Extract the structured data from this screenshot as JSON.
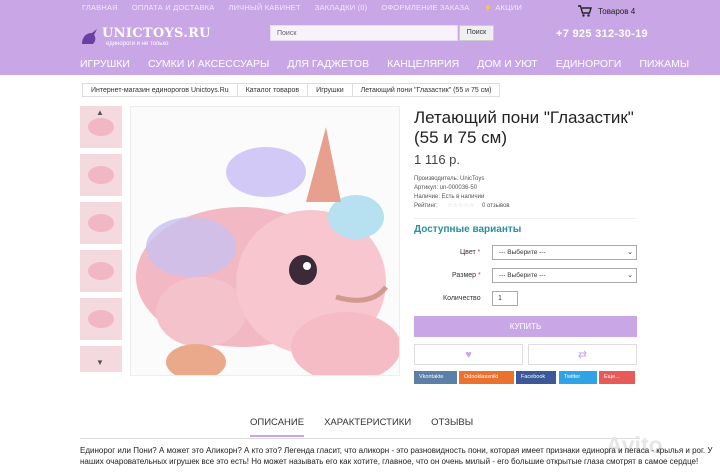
{
  "toplinks": [
    "ГЛАВНАЯ",
    "ОПЛАТА И ДОСТАВКА",
    "ЛИЧНЫЙ КАБИНЕТ",
    "ЗАКЛАДКИ (0)",
    "ОФОРМЛЕНИЕ ЗАКАЗА",
    "АКЦИИ"
  ],
  "cart": {
    "label": "Товаров 4"
  },
  "logo": {
    "main": "UNICTOYS.RU",
    "sub": "единороги и не только"
  },
  "search": {
    "placeholder": "Поиск",
    "button": "Поиск"
  },
  "phone": "+7 925 312-30-19",
  "mainnav": [
    "ИГРУШКИ",
    "СУМКИ И АКСЕССУАРЫ",
    "ДЛЯ ГАДЖЕТОВ",
    "КАНЦЕЛЯРИЯ",
    "ДОМ И УЮТ",
    "ЕДИНОРОГИ",
    "ПИЖАМЫ"
  ],
  "breadcrumb": [
    "Интернет-магазин единорогов Unictoys.Ru",
    "Каталог товаров",
    "Игрушки",
    "Летающий пони \"Глазастик\" (55 и 75 см)"
  ],
  "product": {
    "title": "Летающий пони \"Глазастик\" (55 и 75 см)",
    "price": "1 116 р.",
    "manufacturer": "Производитель: UnicToys",
    "article": "Артикул: un-000036-50",
    "availability": "Наличие: Есть в наличии",
    "rating_label": "Рейтинг:",
    "reviews": "0 отзывов",
    "rating_value": 0
  },
  "variants": {
    "heading": "Доступные варианты",
    "color_label": "Цвет",
    "size_label": "Размер",
    "select_placeholder": "--- Выберите ---",
    "qty_label": "Количество",
    "qty_value": "1",
    "buy": "КУПИТЬ"
  },
  "social": [
    {
      "label": "Vkontakte",
      "color": "#5b7fa6"
    },
    {
      "label": "Odnoklassniki",
      "color": "#eb722e"
    },
    {
      "label": "Facebook",
      "color": "#3b5998"
    },
    {
      "label": "Twitter",
      "color": "#2fa3e6"
    },
    {
      "label": "Еще...",
      "color": "#e65a5a"
    }
  ],
  "tabs": [
    "ОПИСАНИЕ",
    "ХАРАКТЕРИСТИКИ",
    "ОТЗЫВЫ"
  ],
  "description": "Единорог или Пони? А может это Аликорн?  А кто это? Легенда гласит, что аликорн -  это разновидность пони, которая имеет признаки единорга и пегаса - крылья и рог. У наших очаровательных игрушек все это есть! Но может называть его как хотите, главное, что он очень милый - его большие открытые глаза смотрят в самое сердце!",
  "watermark": "Avito",
  "colors": {
    "accent": "#c9a6e6",
    "teal": "#2a8f9e"
  }
}
